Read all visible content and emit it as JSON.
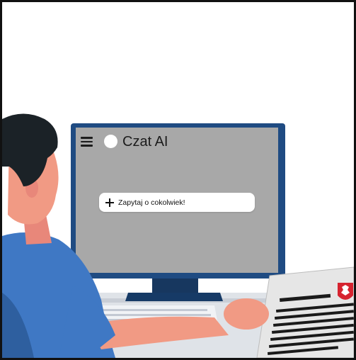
{
  "chat_app": {
    "title": "Czat AI",
    "input_placeholder": "Zapytaj o cokolwiek!",
    "menu_icon": "hamburger-menu-icon",
    "logo_icon": "circle-logo-icon",
    "add_icon": "plus-icon"
  },
  "illustration": {
    "subject": "man-at-computer",
    "document_emblem": "polish-eagle-emblem"
  },
  "colors": {
    "screen": "#a8a8a8",
    "monitor_frame": "#1f4b82",
    "shirt": "#3f78c4",
    "skin": "#f19a84",
    "hair": "#1b2227",
    "desk": "#dfe3e8",
    "paper": "#e8e8e8",
    "emblem_red": "#d6232f"
  }
}
